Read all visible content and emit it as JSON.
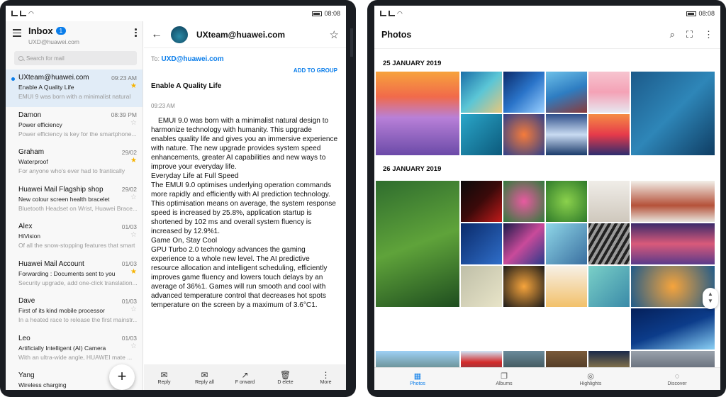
{
  "status_left": {
    "time": "08:08"
  },
  "status_right": {
    "time": "08:08"
  },
  "inbox": {
    "title": "Inbox",
    "badge": "1",
    "account": "UXD@huawei.com",
    "search_placeholder": "Search for mail"
  },
  "mails": [
    {
      "from": "UXteam@huawei.com",
      "date": "09:23 AM",
      "subject": "Enable A Quality Life",
      "preview": "EMUI 9 was born with a minimalist natural",
      "starred": true,
      "unread": true
    },
    {
      "from": "Damon",
      "date": "08:39 PM",
      "subject": "Power efficiency",
      "preview": "Power efficiency is key for the smartphone...",
      "starred": false,
      "unread": false
    },
    {
      "from": "Graham",
      "date": "29/02",
      "subject": "Waterproof",
      "preview": "For anyone who's ever had to frantically",
      "starred": true,
      "unread": false
    },
    {
      "from": "Huawei Mail Flagship shop",
      "date": "29/02",
      "subject": "New colour screen health bracelet",
      "preview": "Bluetooth Headset on Wrist, Huawei Brace...",
      "starred": false,
      "unread": false
    },
    {
      "from": "Alex",
      "date": "01/03",
      "subject": "HiVision",
      "preview": "Of all the snow-stopping features that smart",
      "starred": false,
      "unread": false
    },
    {
      "from": "Huawei Mail Account",
      "date": "01/03",
      "subject": "Forwarding : Documents sent to you",
      "preview": "Security upgrade, add one-click translation...",
      "starred": true,
      "unread": false
    },
    {
      "from": "Dave",
      "date": "01/03",
      "subject": "First of its kind mobile processor",
      "preview": "In a heated race to release the first mainstr...",
      "starred": false,
      "unread": false
    },
    {
      "from": "Leo",
      "date": "01/03",
      "subject": "Artificially Intelligent (AI) Camera",
      "preview": "With an ultra-wide angle, HUAWEI mate ...",
      "starred": false,
      "unread": false
    },
    {
      "from": "Yang",
      "date": "",
      "subject": "Wireless charging",
      "preview": "",
      "starred": false,
      "unread": false
    }
  ],
  "fab": "+",
  "reader": {
    "from": "UXteam@huawei.com",
    "to_label": "To:",
    "to": "UXD@huawei.com",
    "add_to_group": "ADD TO GROUP",
    "subject": "Enable A Quality Life",
    "time": "09:23 AM",
    "body": [
      "EMUI 9.0 was born with a minimalist natural design to harmonize technology with humanity. This upgrade enables quality life and gives you an immersive experience with nature. The new upgrade provides system speed enhancements, greater AI capabilities and new ways to improve your everyday life.",
      "Everyday Life at Full Speed",
      "The EMUI 9.0 optimises underlying operation commands more rapidly and efficiently with AI prediction technology. This optimisation means on average, the system response speed is increased by 25.8%, application startup is shortened by 102 ms and overall system fluency is increased by 12.9%1.",
      "Game On, Stay Cool",
      "GPU Turbo 2.0 technology advances the gaming experience to a whole new level. The AI predictive resource allocation and intelligent scheduling, efficiently improves game fluency and lowers touch delays by an average of 36%1. Games will run smooth and cool with advanced temperature control that decreases hot spots temperature on the screen by a maximum of 3.6°C1."
    ],
    "toolbar": [
      "Reply",
      "Reply all",
      "F orward",
      "D elete",
      "More"
    ]
  },
  "photos": {
    "title": "Photos",
    "date1": "25 JANUARY 2019",
    "date2": "26 JANUARY 2019",
    "tabs": [
      "Photos",
      "Albums",
      "Highlights",
      "Discover"
    ],
    "active_tab": "Photos"
  },
  "colors": {
    "accent": "#0a7dea",
    "star": "#f6b300",
    "selected_row": "#e1ecf7"
  }
}
